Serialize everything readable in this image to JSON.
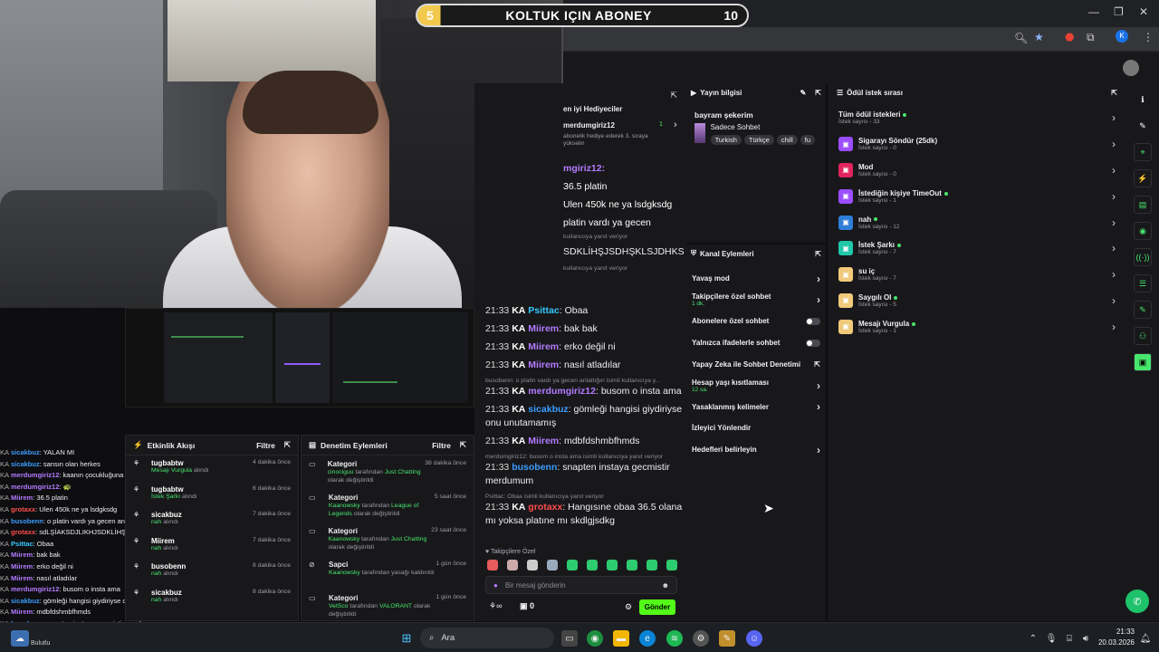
{
  "scorebar": {
    "left": "5",
    "title": "KOLTUK IÇIN ABONEY",
    "right": "10"
  },
  "overlay_chat": [
    {
      "user": "sicakbuz",
      "color": "#3b9cff",
      "text": ": YALAN MI"
    },
    {
      "user": "sicakbuz",
      "color": "#3b9cff",
      "text": ": sansın olan herkes"
    },
    {
      "user": "merdumgiriz12",
      "color": "#b37bff",
      "text": ": kaanın çocukluğuna inelim hadi 🥺"
    },
    {
      "user": "merdumgiriz12",
      "color": "#b37bff",
      "text": ": 🐢"
    },
    {
      "user": "Miirem",
      "color": "#b37bff",
      "text": ": 36.5 platin"
    },
    {
      "user": "grotaxx",
      "color": "#ff4d4d",
      "text": ": Ulen 450k ne ya lsdgksdg"
    },
    {
      "user": "busobenn",
      "color": "#3b9cff",
      "text": ": o platin vardı ya gecen anlattığın"
    },
    {
      "user": "grotaxx",
      "color": "#ff4d4d",
      "text": ": sdLŞİAKSDJLIKHJSDKLİHŞJSDHŞKLSJDHKSJDHKLSDJSD"
    },
    {
      "user": "Psittac",
      "color": "#37c9ff",
      "text": ": Obaa"
    },
    {
      "user": "Miirem",
      "color": "#b37bff",
      "text": ": bak bak"
    },
    {
      "user": "Miirem",
      "color": "#b37bff",
      "text": ": erko değil ni"
    },
    {
      "user": "Miirem",
      "color": "#b37bff",
      "text": ": nasıl atladılar"
    },
    {
      "user": "merdumgiriz12",
      "color": "#b37bff",
      "text": ": busom o insta ama"
    },
    {
      "user": "sicakbuz",
      "color": "#3b9cff",
      "text": ": gömleği hangisi giydiriyse onu unutamamış"
    },
    {
      "user": "Miirem",
      "color": "#b37bff",
      "text": ": mdbfdshmbfhmds"
    },
    {
      "user": "busobenn",
      "color": "#3b9cff",
      "text": ": snapten instaya gecmistir merdumum"
    },
    {
      "user": "grotaxx",
      "color": "#ff4d4d",
      "text": ": Hangısıne obaa 36.5 olana mı yoksa platıne mı skdlgjsdkg"
    }
  ],
  "activity": {
    "title": "Etkinlik Akışı",
    "filter": "Filtre",
    "items": [
      {
        "name": "tugbabtw",
        "desc": "Mesajı Vurgula",
        "desc2": " alındı",
        "time": "4 dakika önce"
      },
      {
        "name": "tugbabtw",
        "desc": "İstek Şarkı",
        "desc2": " alındı",
        "time": "6 dakika önce"
      },
      {
        "name": "sicakbuz",
        "desc": "nah",
        "desc2": " alındı",
        "time": "7 dakika önce"
      },
      {
        "name": "Miirem",
        "desc": "nah",
        "desc2": " alındı",
        "time": "7 dakika önce"
      },
      {
        "name": "busobenn",
        "desc": "nah",
        "desc2": " alındı",
        "time": "8 dakika önce"
      },
      {
        "name": "sicakbuz",
        "desc": "nah",
        "desc2": " alındı",
        "time": "8 dakika önce"
      }
    ]
  },
  "moderation": {
    "title": "Denetim Eylemleri",
    "filter": "Filtre",
    "items": [
      {
        "name": "Kategori",
        "a": "cinociguu",
        "b": " tarafından ",
        "c": "Just Chatting",
        "d": " olarak değiştirildi",
        "time": "38 dakika önce"
      },
      {
        "name": "Kategori",
        "a": "Kaanowsky",
        "b": " tarafından ",
        "c": "League of Legends",
        "d": " olarak değiştirildi",
        "time": "5 saat önce"
      },
      {
        "name": "Kategori",
        "a": "Kaanowsky",
        "b": " tarafından ",
        "c": "Just Chatting",
        "d": " olarak değiştirildi",
        "time": "23 saat önce"
      },
      {
        "name": "Sapci",
        "a": "Kaanowsky",
        "b": " tarafından yasağı kaldırıldı",
        "c": "",
        "d": "",
        "time": "1 gün önce"
      },
      {
        "name": "Kategori",
        "a": "VetSco",
        "b": " tarafından ",
        "c": "VALORANT",
        "d": " olarak değiştirildi",
        "time": "1 gün önce"
      },
      {
        "name": "Kategori",
        "a": "",
        "b": "",
        "c": "",
        "d": "",
        "time": ""
      }
    ]
  },
  "chat": {
    "top_gifters": "en iyi Hediyeciler",
    "gifter_name": "merdumgiriz12",
    "gifter_desc": "abonelik hediye ederek 3. sıraya",
    "gifter_desc2": "yükselin",
    "gifter_count": "1",
    "partial": [
      {
        "text": "mgiriz12:",
        "color": "#b37bff"
      },
      {
        "text": "36.5 platin",
        "color": "#fff"
      },
      {
        "text": "Ulen 450k ne ya lsdgksdg",
        "color": "#fff"
      },
      {
        "text": "platin vardı ya gecen",
        "color": "#fff"
      }
    ],
    "partial_reply": "kullanıcıya yanıt veriyor",
    "partial_long": "SDKLİHŞJSDHŞKLSJDHKS",
    "partial_reply2": "kullanıcıya yanıt veriyor",
    "messages": [
      {
        "time": "21:33",
        "badge": "KA",
        "user": "Psittac",
        "color": "#37c9ff",
        "text": ": Obaa",
        "reply": ""
      },
      {
        "time": "21:33",
        "badge": "KA",
        "user": "Miirem",
        "color": "#b37bff",
        "text": ": bak bak",
        "reply": ""
      },
      {
        "time": "21:33",
        "badge": "KA",
        "user": "Miirem",
        "color": "#b37bff",
        "text": ": erko değil ni",
        "reply": ""
      },
      {
        "time": "21:33",
        "badge": "KA",
        "user": "Miirem",
        "color": "#b37bff",
        "text": ": nasıl atladılar",
        "reply": ""
      },
      {
        "time": "21:33",
        "badge": "KA",
        "user": "merdumgiriz12",
        "color": "#b37bff",
        "text": ": busom o insta ama",
        "reply": "busobenn: o platin vardı ya gecen anlattığın isimli kullanıcıya y..."
      },
      {
        "time": "21:33",
        "badge": "KA",
        "user": "sicakbuz",
        "color": "#3b9cff",
        "text": ": gömleği hangisi giydiriyse onu unutamamış",
        "reply": ""
      },
      {
        "time": "21:33",
        "badge": "KA",
        "user": "Miirem",
        "color": "#b37bff",
        "text": ": mdbfdshmbfhmds",
        "reply": ""
      },
      {
        "time": "21:33",
        "badge": "",
        "user": "busobenn",
        "color": "#3b9cff",
        "text": ": snapten instaya gecmistir merdumum",
        "reply": "merdumgiriz12: busom o insta ama isimli kullanıcıya yanıt veriyor"
      },
      {
        "time": "21:33",
        "badge": "KA",
        "user": "grotaxx",
        "color": "#ff4d4d",
        "text": ": Hangısıne obaa 36.5 olana mı yoksa platıne mı skdlgjsdkg",
        "reply": "Psittac: Obaa isimli kullanıcıya yanıt veriyor"
      }
    ],
    "followers_only": "Takipçilere Özel",
    "input_placeholder": "Bir mesaj gönderin",
    "points": "0",
    "send": "Gönder"
  },
  "stream_info": {
    "title": "Yayın bilgisi",
    "stream_title": "bayram şekerim",
    "category": "Sadece Sohbet",
    "tags": [
      "Turkish",
      "Türkçe",
      "chill",
      "fu"
    ]
  },
  "channel_actions": {
    "title": "Kanal Eylemleri",
    "items": [
      {
        "label": "Yavaş mod",
        "sub": "",
        "type": "chev"
      },
      {
        "label": "Takipçilere özel sohbet",
        "sub": "1 dk.",
        "type": "chev"
      },
      {
        "label": "Abonelere özel sohbet",
        "sub": "",
        "type": "toggle"
      },
      {
        "label": "Yalnızca ifadelerle sohbet",
        "sub": "",
        "type": "toggle"
      },
      {
        "label": "Yapay Zeka ile Sohbet Denetimi",
        "sub": "",
        "type": "ext"
      },
      {
        "label": "Hesap yaşı kısıtlaması",
        "sub": "12 sa.",
        "type": "chev"
      },
      {
        "label": "Yasaklanmış kelimeler",
        "sub": "",
        "type": "chev"
      },
      {
        "label": "İzleyici Yönlendir",
        "sub": "",
        "type": "none"
      },
      {
        "label": "Hedefleri belirleyin",
        "sub": "",
        "type": "chev"
      }
    ]
  },
  "rewards": {
    "title": "Ödül istek sırası",
    "items": [
      {
        "name": "Tüm ödül istekleri",
        "count": "İstek sayısı - 33",
        "color": "",
        "dot": true,
        "icon": false
      },
      {
        "name": "Sigarayı Söndür (25dk)",
        "count": "İstek sayısı - 0",
        "color": "#9b4dff",
        "dot": false,
        "icon": true
      },
      {
        "name": "Mod",
        "count": "İstek sayısı - 0",
        "color": "#e0245e",
        "dot": false,
        "icon": true
      },
      {
        "name": "İstediğin kişiye TimeOut",
        "count": "İstek sayısı - 1",
        "color": "#9b4dff",
        "dot": true,
        "icon": true
      },
      {
        "name": "nah",
        "count": "İstek sayısı - 12",
        "color": "#2e7dd7",
        "dot": true,
        "icon": true
      },
      {
        "name": "İstek Şarkı",
        "count": "İstek sayısı - 7",
        "color": "#22c7a9",
        "dot": true,
        "icon": true
      },
      {
        "name": "su iç",
        "count": "İstek sayısı - 7",
        "color": "#f0c97a",
        "dot": false,
        "icon": true
      },
      {
        "name": "Saygılı Ol",
        "count": "İstek sayısı - 5",
        "color": "#f0c97a",
        "dot": true,
        "icon": true
      },
      {
        "name": "Mesajı Vurgula",
        "count": "İstek sayısı - 1",
        "color": "#f0c97a",
        "dot": true,
        "icon": true
      }
    ]
  },
  "taskbar": {
    "search": "Ara",
    "time": "21:33",
    "date": "20.03.2026",
    "weather": "Bulutlu"
  }
}
